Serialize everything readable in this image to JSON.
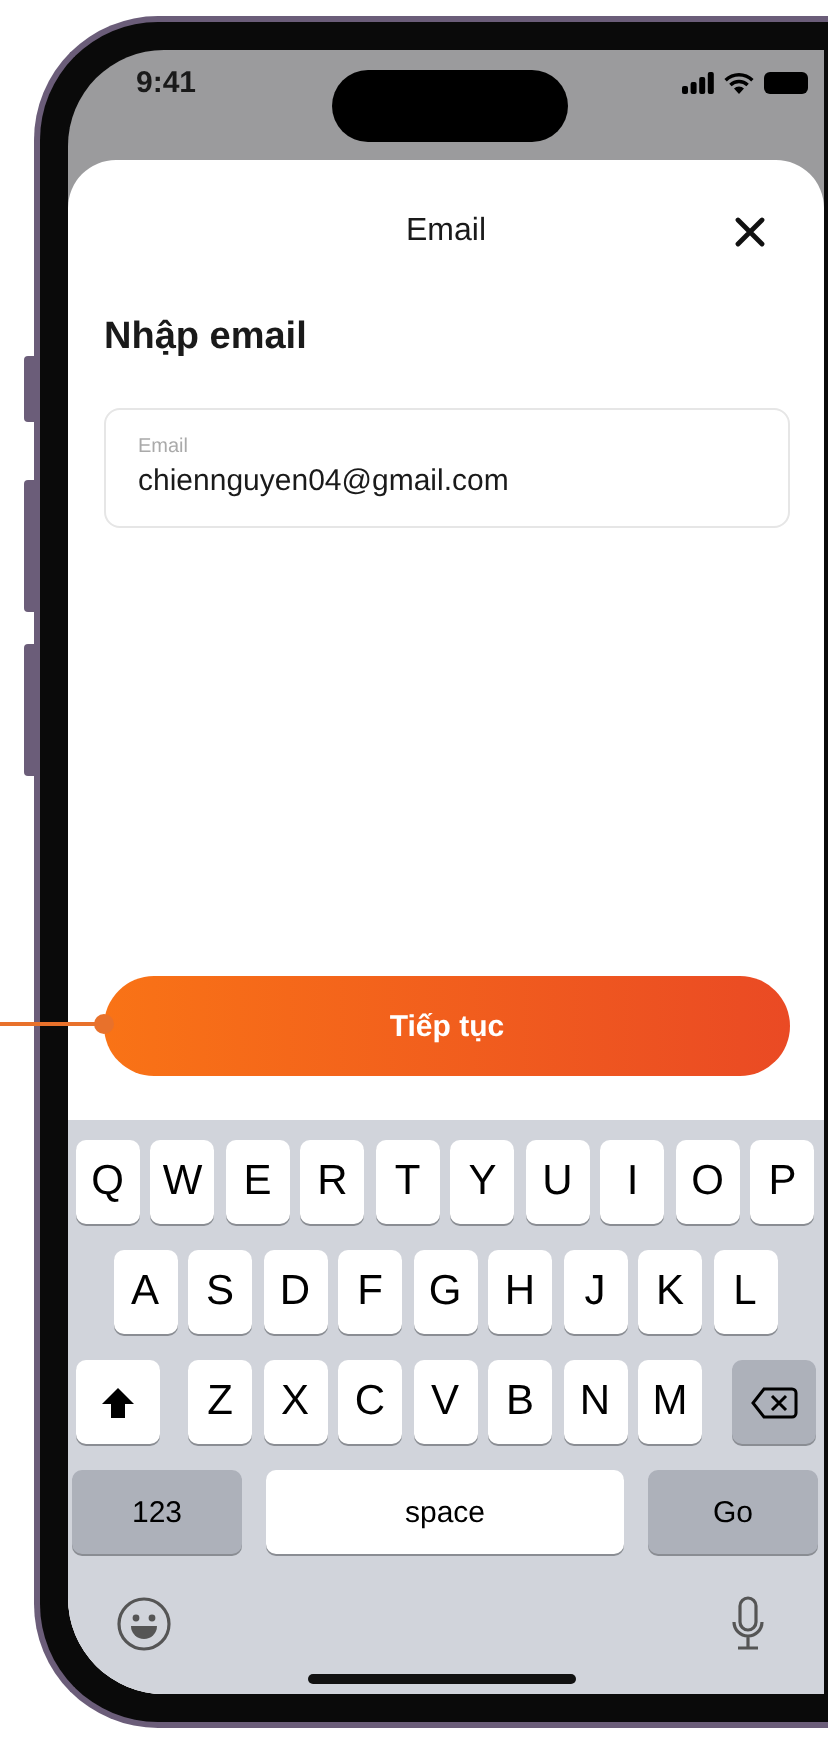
{
  "status_bar": {
    "time": "9:41"
  },
  "sheet": {
    "title": "Email",
    "heading": "Nhập email",
    "email_field": {
      "label": "Email",
      "value": "chiennguyen04@gmail.com"
    },
    "continue_button": "Tiếp tục"
  },
  "keyboard": {
    "letter_rows": [
      {
        "keys": [
          {
            "kind": "letter",
            "label": "Q"
          },
          {
            "kind": "letter",
            "label": "W"
          },
          {
            "kind": "letter",
            "label": "E"
          },
          {
            "kind": "letter",
            "label": "R"
          },
          {
            "kind": "letter",
            "label": "T"
          },
          {
            "kind": "letter",
            "label": "Y"
          },
          {
            "kind": "letter",
            "label": "U"
          },
          {
            "kind": "letter",
            "label": "I"
          },
          {
            "kind": "letter",
            "label": "O"
          },
          {
            "kind": "letter",
            "label": "P"
          }
        ]
      },
      {
        "keys": [
          {
            "kind": "letter",
            "label": "A"
          },
          {
            "kind": "letter",
            "label": "S"
          },
          {
            "kind": "letter",
            "label": "D"
          },
          {
            "kind": "letter",
            "label": "F"
          },
          {
            "kind": "letter",
            "label": "G"
          },
          {
            "kind": "letter",
            "label": "H"
          },
          {
            "kind": "letter",
            "label": "J"
          },
          {
            "kind": "letter",
            "label": "K"
          },
          {
            "kind": "letter",
            "label": "L"
          }
        ]
      },
      {
        "keys": [
          {
            "kind": "shift"
          },
          {
            "kind": "letter",
            "label": "Z"
          },
          {
            "kind": "letter",
            "label": "X"
          },
          {
            "kind": "letter",
            "label": "C"
          },
          {
            "kind": "letter",
            "label": "V"
          },
          {
            "kind": "letter",
            "label": "B"
          },
          {
            "kind": "letter",
            "label": "N"
          },
          {
            "kind": "letter",
            "label": "M"
          },
          {
            "kind": "backspace"
          }
        ]
      }
    ],
    "bottom_keys": [
      {
        "kind": "mode",
        "label": "123"
      },
      {
        "kind": "space",
        "label": "space"
      },
      {
        "kind": "action",
        "label": "Go"
      }
    ]
  }
}
